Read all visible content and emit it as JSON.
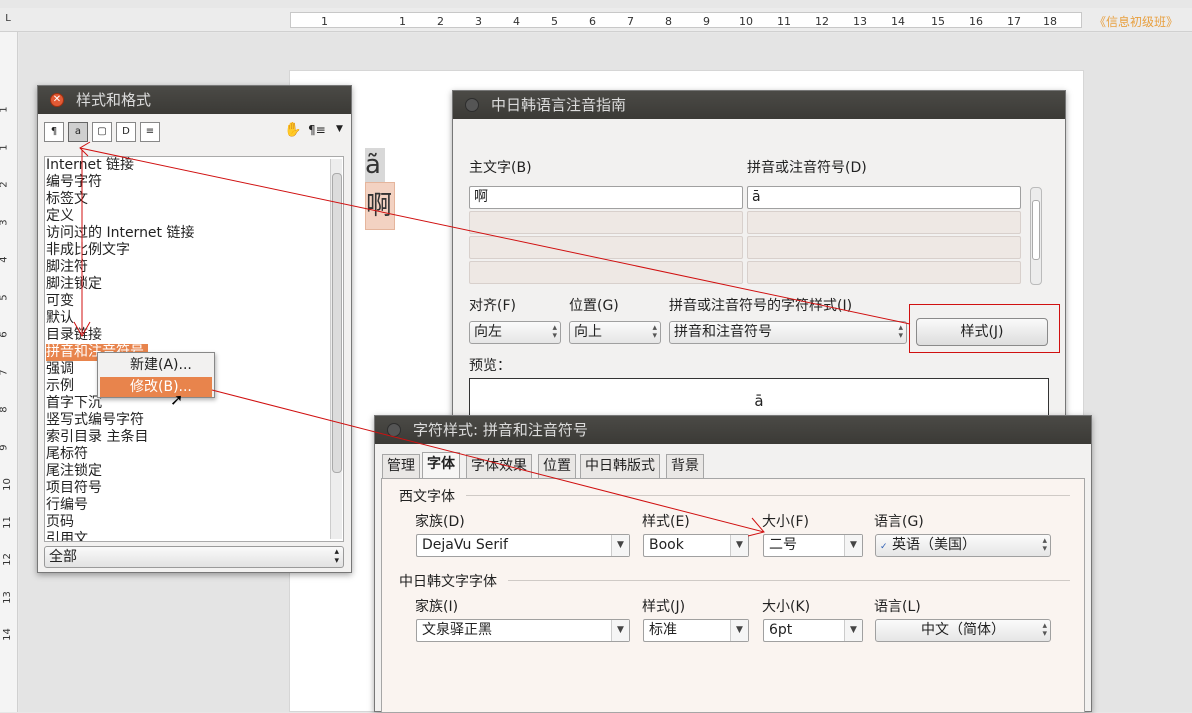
{
  "ruler": {
    "corner": "L",
    "ticks": [
      "1",
      "1",
      "2",
      "3",
      "4",
      "5",
      "6",
      "7",
      "8",
      "9",
      "10",
      "11",
      "12",
      "13",
      "14",
      "15",
      "16",
      "17",
      "18"
    ],
    "right_label": "《信息初级班》",
    "left_ticks": [
      "1",
      "1",
      "2",
      "3",
      "4",
      "5",
      "6",
      "7",
      "8",
      "9",
      "10",
      "11",
      "12",
      "13",
      "14"
    ]
  },
  "document": {
    "ruby_text": "ã",
    "base_text": "啊"
  },
  "styles_panel": {
    "title": "样式和格式",
    "fill_format_icon": "¶≡",
    "list": [
      "Internet 链接",
      "编号字符",
      "标签文",
      "定义",
      "访问过的 Internet 链接",
      "非成比例文字",
      "脚注符",
      "脚注锁定",
      "可变",
      "默认",
      "目录链接",
      "拼音和注音符号",
      "强调",
      "示例",
      "首字下沉",
      "竖写式编号字符",
      "索引目录 主条目",
      "尾标符",
      "尾注锁定",
      "项目符号",
      "行编号",
      "页码",
      "引用文"
    ],
    "selected_index": 11,
    "filter_value": "全部"
  },
  "context_menu": {
    "items": [
      "新建(A)...",
      "修改(B)..."
    ],
    "highlighted_index": 1
  },
  "ruby_dialog": {
    "title": "中日韩语言注音指南",
    "base_label": "主文字(B)",
    "ruby_label": "拼音或注音符号(D)",
    "rows": [
      {
        "base": "啊",
        "ruby": "ā"
      },
      {
        "base": "",
        "ruby": ""
      },
      {
        "base": "",
        "ruby": ""
      },
      {
        "base": "",
        "ruby": ""
      }
    ],
    "align_label": "对齐(F)",
    "align_value": "向左",
    "position_label": "位置(G)",
    "position_value": "向上",
    "char_style_label": "拼音或注音符号的字符样式(I)",
    "char_style_value": "拼音和注音符号",
    "style_button": "样式(J)",
    "preview_label": "预览：",
    "preview_text": "ā"
  },
  "char_dialog": {
    "title": "字符样式: 拼音和注音符号",
    "tabs": [
      "管理",
      "字体",
      "字体效果",
      "位置",
      "中日韩版式",
      "背景"
    ],
    "active_tab": 1,
    "western": {
      "section": "西文字体",
      "family_label": "家族(D)",
      "family_value": "DejaVu Serif",
      "style_label": "样式(E)",
      "style_value": "Book",
      "size_label": "大小(F)",
      "size_value": "二号",
      "lang_label": "语言(G)",
      "lang_value": "英语（美国）"
    },
    "cjk": {
      "section": "中日韩文字字体",
      "family_label": "家族(I)",
      "family_value": "文泉驿正黑",
      "style_label": "样式(J)",
      "style_value": "标准",
      "size_label": "大小(K)",
      "size_value": "6pt",
      "lang_label": "语言(L)",
      "lang_value": "中文（简体）"
    }
  },
  "colors": {
    "selection": "#e8844c",
    "annotation": "#d01010",
    "titlebar": "#3c3b37"
  },
  "icons": [
    "close-icon",
    "paragraph-styles-icon",
    "character-styles-icon",
    "frame-styles-icon",
    "page-styles-icon",
    "list-styles-icon",
    "fill-format-icon",
    "new-style-menu-icon",
    "abc-spellcheck-icon",
    "mouse-pointer-icon"
  ]
}
